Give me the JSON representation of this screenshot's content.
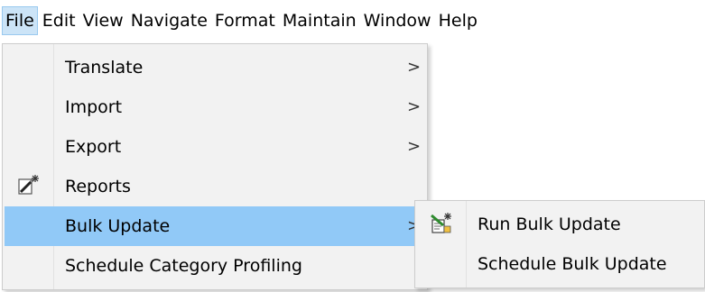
{
  "menubar": {
    "items": [
      "File",
      "Edit",
      "View",
      "Navigate",
      "Format",
      "Maintain",
      "Window",
      "Help"
    ]
  },
  "file_menu": {
    "items": [
      {
        "label": "Translate",
        "submenu_arrow": ">"
      },
      {
        "label": "Import",
        "submenu_arrow": ">"
      },
      {
        "label": "Export",
        "submenu_arrow": ">"
      },
      {
        "label": "Reports",
        "icon": "magic-wand-icon"
      },
      {
        "label": "Bulk Update",
        "submenu_arrow": ">",
        "highlighted": true
      },
      {
        "label": "Schedule Category Profiling"
      }
    ]
  },
  "bulk_update_submenu": {
    "items": [
      {
        "label": "Run Bulk Update",
        "icon": "run-bulk-update-icon"
      },
      {
        "label": "Schedule Bulk Update"
      }
    ]
  },
  "colors": {
    "menu_background": "#f2f2f2",
    "highlight": "#91c9f7",
    "active_menubar_item": "#cce4f7"
  }
}
